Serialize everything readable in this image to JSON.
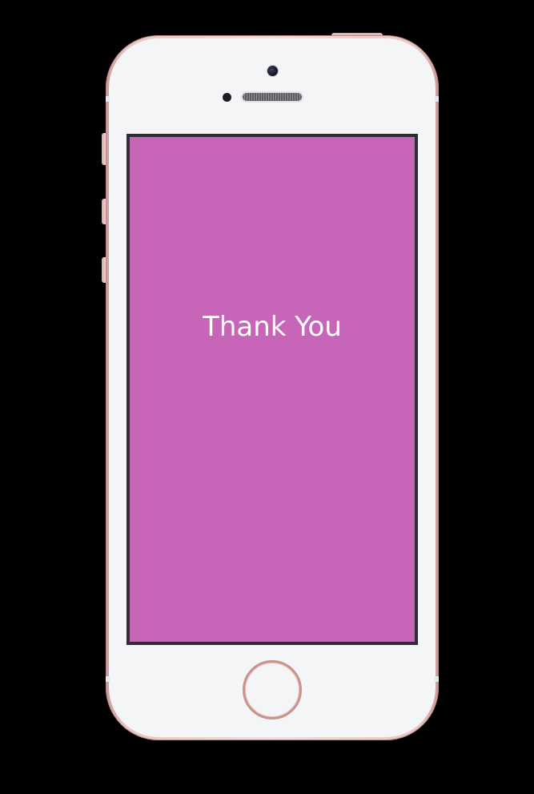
{
  "device": {
    "frame_color": "#eecfcb",
    "face_color": "#f4f5f7"
  },
  "screen": {
    "background_color": "#c765b9",
    "message": "Thank You"
  }
}
